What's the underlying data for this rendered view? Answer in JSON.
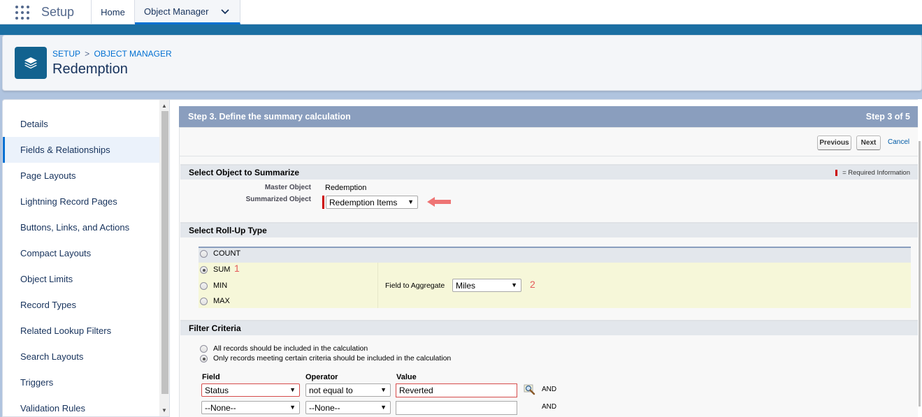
{
  "topnav": {
    "app_name": "Setup",
    "tab_home": "Home",
    "tab_object_manager": "Object Manager"
  },
  "header": {
    "breadcrumb_setup": "SETUP",
    "breadcrumb_sep": ">",
    "breadcrumb_object_manager": "OBJECT MANAGER",
    "title": "Redemption"
  },
  "sidebar": {
    "items": [
      {
        "label": "Details"
      },
      {
        "label": "Fields & Relationships"
      },
      {
        "label": "Page Layouts"
      },
      {
        "label": "Lightning Record Pages"
      },
      {
        "label": "Buttons, Links, and Actions"
      },
      {
        "label": "Compact Layouts"
      },
      {
        "label": "Object Limits"
      },
      {
        "label": "Record Types"
      },
      {
        "label": "Related Lookup Filters"
      },
      {
        "label": "Search Layouts"
      },
      {
        "label": "Triggers"
      },
      {
        "label": "Validation Rules"
      }
    ],
    "active_index": 1
  },
  "step": {
    "title": "Step 3. Define the summary calculation",
    "counter": "Step 3 of 5",
    "previous_label": "Previous",
    "next_label": "Next",
    "cancel_label": "Cancel"
  },
  "object_section": {
    "title": "Select Object to Summarize",
    "required_legend": "= Required Information",
    "master_label": "Master Object",
    "master_value": "Redemption",
    "summarized_label": "Summarized Object",
    "summarized_value": "Redemption Items"
  },
  "rollup_section": {
    "title": "Select Roll-Up Type",
    "options": [
      {
        "label": "COUNT",
        "checked": false
      },
      {
        "label": "SUM",
        "checked": true
      },
      {
        "label": "MIN",
        "checked": false
      },
      {
        "label": "MAX",
        "checked": false
      }
    ],
    "field_to_aggregate_label": "Field to Aggregate",
    "field_to_aggregate_value": "Miles",
    "annotation_1": "1",
    "annotation_2": "2"
  },
  "filter_section": {
    "title": "Filter Criteria",
    "option_all": "All records should be included in the calculation",
    "option_criteria": "Only records meeting certain criteria should be included in the calculation",
    "selected": "criteria",
    "col_field": "Field",
    "col_operator": "Operator",
    "col_value": "Value",
    "rows": [
      {
        "field": "Status",
        "operator": "not equal to",
        "value": "Reverted",
        "conjunction": "AND"
      },
      {
        "field": "--None--",
        "operator": "--None--",
        "value": "",
        "conjunction": "AND"
      }
    ]
  },
  "colors": {
    "accent": "#0070d2",
    "band": "#1b6fa3",
    "step_header": "#8a9ebe",
    "annotation": "#e45a5a",
    "required": "#cc0000"
  }
}
